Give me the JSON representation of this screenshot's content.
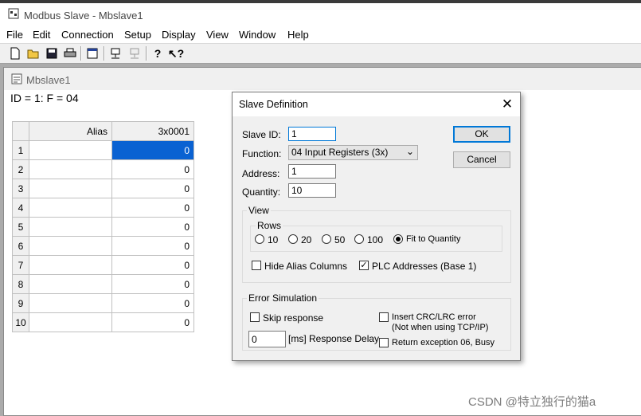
{
  "app": {
    "title": "Modbus Slave - Mbslave1"
  },
  "menu": [
    "File",
    "Edit",
    "Connection",
    "Setup",
    "Display",
    "View",
    "Window",
    "Help"
  ],
  "toolbar": {
    "icons": [
      "new-icon",
      "open-icon",
      "save-icon",
      "print-icon",
      "window-icon",
      "connect-icon",
      "disconnect-icon",
      "help-icon",
      "context-help-icon"
    ]
  },
  "child": {
    "title": "Mbslave1",
    "status": "ID = 1: F = 04",
    "grid": {
      "alias_header": "Alias",
      "value_header": "3x0001",
      "rows": [
        {
          "n": "1",
          "value": "0"
        },
        {
          "n": "2",
          "value": "0"
        },
        {
          "n": "3",
          "value": "0"
        },
        {
          "n": "4",
          "value": "0"
        },
        {
          "n": "5",
          "value": "0"
        },
        {
          "n": "6",
          "value": "0"
        },
        {
          "n": "7",
          "value": "0"
        },
        {
          "n": "8",
          "value": "0"
        },
        {
          "n": "9",
          "value": "0"
        },
        {
          "n": "10",
          "value": "0"
        }
      ]
    }
  },
  "dialog": {
    "title": "Slave Definition",
    "slave_id_label": "Slave ID:",
    "slave_id": "1",
    "function_label": "Function:",
    "function": "04 Input Registers (3x)",
    "address_label": "Address:",
    "address": "1",
    "quantity_label": "Quantity:",
    "quantity": "10",
    "ok": "OK",
    "cancel": "Cancel",
    "view": {
      "label": "View",
      "rows_label": "Rows",
      "rows_options": [
        {
          "label": "10",
          "selected": false
        },
        {
          "label": "20",
          "selected": false
        },
        {
          "label": "50",
          "selected": false
        },
        {
          "label": "100",
          "selected": false
        },
        {
          "label": "Fit to Quantity",
          "selected": true
        }
      ],
      "hide_alias": {
        "label": "Hide Alias Columns",
        "checked": false
      },
      "plc_addresses": {
        "label": "PLC Addresses (Base 1)",
        "checked": true
      }
    },
    "error_sim": {
      "label": "Error Simulation",
      "skip_response": {
        "label": "Skip response",
        "checked": false
      },
      "delay_value": "0",
      "delay_label": "[ms] Response Delay",
      "insert_crc": {
        "label": "Insert CRC/LRC error",
        "checked": false
      },
      "insert_crc_note": "(Not when using TCP/IP)",
      "return_exception": {
        "label": "Return exception 06, Busy",
        "checked": false
      }
    }
  },
  "watermark": "CSDN @特立独行的猫a"
}
